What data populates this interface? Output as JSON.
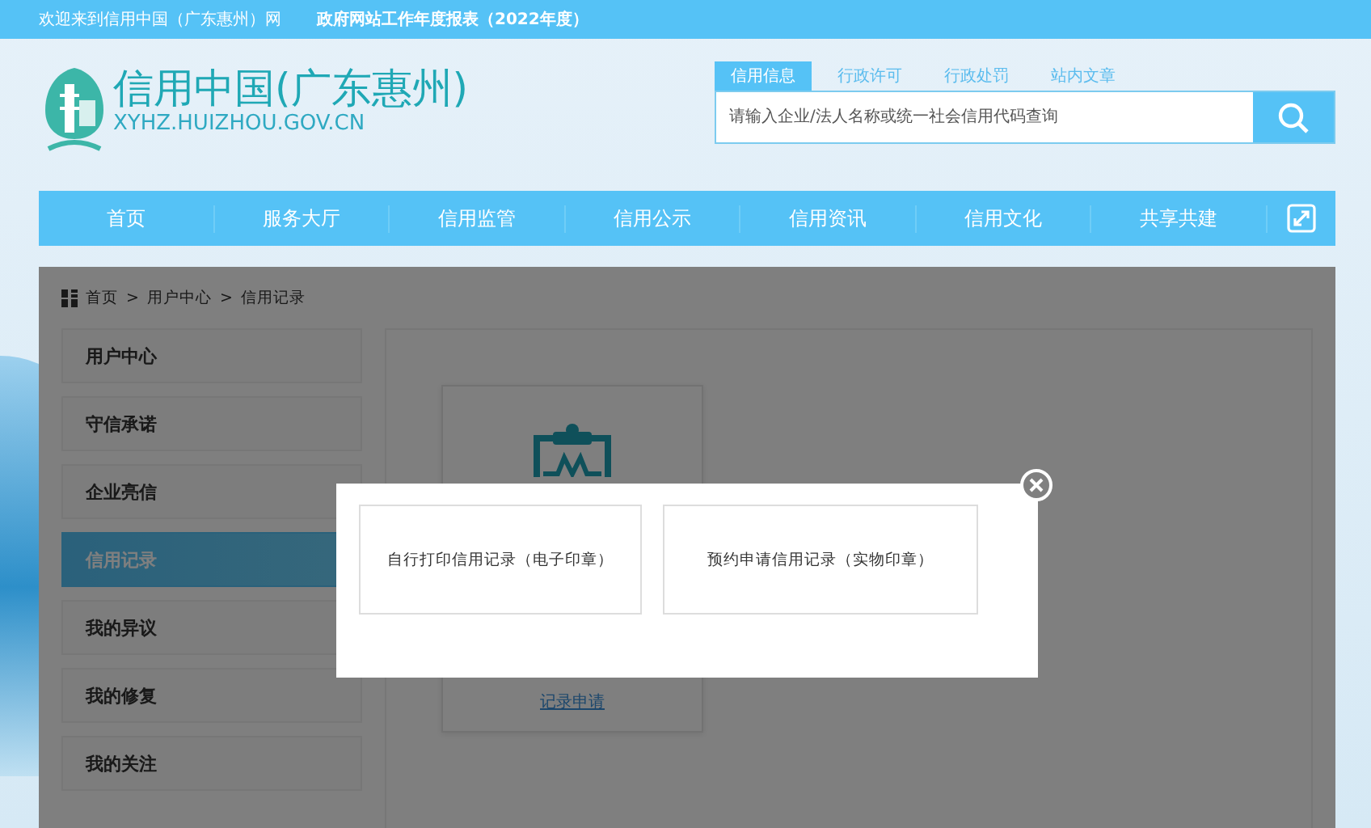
{
  "top_bar": {
    "welcome": "欢迎来到信用中国（广东惠州）网",
    "report_link": "政府网站工作年度报表（2022年度）"
  },
  "header": {
    "site_title": "信用中国(广东惠州)",
    "site_domain": "XYHZ.HUIZHOU.GOV.CN"
  },
  "search": {
    "tabs": [
      {
        "label": "信用信息",
        "selected": true
      },
      {
        "label": "行政许可",
        "selected": false
      },
      {
        "label": "行政处罚",
        "selected": false
      },
      {
        "label": "站内文章",
        "selected": false
      }
    ],
    "placeholder": "请输入企业/法人名称或统一社会信用代码查询"
  },
  "nav": {
    "items": [
      "首页",
      "服务大厅",
      "信用监管",
      "信用公示",
      "信用资讯",
      "信用文化",
      "共享共建"
    ]
  },
  "breadcrumb": [
    "首页",
    ">",
    "用户中心",
    ">",
    "信用记录"
  ],
  "sidebar": {
    "items": [
      {
        "label": "用户中心",
        "selected": false
      },
      {
        "label": "守信承诺",
        "selected": false
      },
      {
        "label": "企业亮信",
        "selected": false
      },
      {
        "label": "信用记录",
        "selected": true
      },
      {
        "label": "我的异议",
        "selected": false
      },
      {
        "label": "我的修复",
        "selected": false
      },
      {
        "label": "我的关注",
        "selected": false
      }
    ]
  },
  "card": {
    "link": "记录申请"
  },
  "modal": {
    "options": [
      "自行打印信用记录（电子印章）",
      "预约申请信用记录（实物印章）"
    ]
  }
}
